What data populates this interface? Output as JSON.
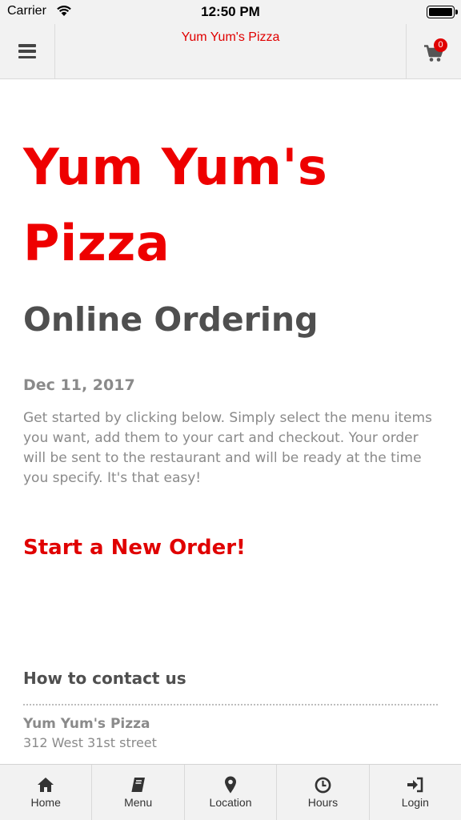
{
  "status_bar": {
    "carrier": "Carrier",
    "time": "12:50 PM"
  },
  "header": {
    "title": "Yum Yum's Pizza",
    "cart_count": "0",
    "icons": {
      "menu": "hamburger-icon",
      "cart": "cart-icon"
    }
  },
  "main": {
    "title": "Yum Yum's Pizza",
    "subtitle": "Online Ordering",
    "date": "Dec 11, 2017",
    "intro": "Get started by clicking below. Simply select the menu items you want, add them to your cart and checkout. Your order will be sent to the restaurant and will be ready at the time you specify. It's that easy!",
    "cta": "Start a New Order!"
  },
  "contact": {
    "heading": "How to contact us",
    "name": "Yum Yum's Pizza",
    "address": "312 West 31st street"
  },
  "tab_bar": {
    "items": [
      {
        "label": "Home",
        "icon": "home-icon"
      },
      {
        "label": "Menu",
        "icon": "book-icon"
      },
      {
        "label": "Location",
        "icon": "map-pin-icon"
      },
      {
        "label": "Hours",
        "icon": "clock-icon"
      },
      {
        "label": "Login",
        "icon": "sign-in-icon"
      }
    ]
  },
  "colors": {
    "accent": "#e00000",
    "heading": "#4f4f4f",
    "muted": "#8a8a8a",
    "bar_background": "#f2f2f2"
  }
}
